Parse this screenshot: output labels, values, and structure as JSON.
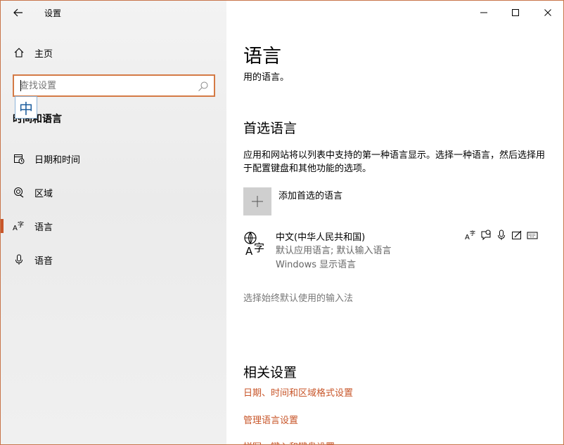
{
  "app": {
    "title": "设置"
  },
  "sidebar": {
    "home_label": "主页",
    "search": {
      "placeholder": "查找设置"
    },
    "ime_indicator": "中",
    "section_title": "时间和语言",
    "items": [
      {
        "label": "日期和时间",
        "icon": "calendar-clock-icon",
        "active": false
      },
      {
        "label": "区域",
        "icon": "globe-region-icon",
        "active": false
      },
      {
        "label": "语言",
        "icon": "language-icon",
        "active": true
      },
      {
        "label": "语音",
        "icon": "microphone-icon",
        "active": false
      }
    ]
  },
  "main": {
    "title": "语言",
    "subtitle": "用的语言。",
    "preferred": {
      "heading": "首选语言",
      "description": "应用和网站将以列表中支持的第一种语言显示。选择一种语言，然后选择用于配置键盘和其他功能的选项。",
      "add_label": "添加首选的语言",
      "language": {
        "name": "中文(中华人民共和国)",
        "detail1": "默认应用语言; 默认输入语言",
        "detail2": "Windows 显示语言",
        "feature_icons": [
          "text-language-icon",
          "speech-bubble-icon",
          "microphone-icon",
          "handwriting-icon",
          "keyboard-icon"
        ]
      }
    },
    "input_method_link": "选择始终默认使用的输入法",
    "related": {
      "heading": "相关设置",
      "links": [
        "日期、时间和区域格式设置",
        "管理语言设置",
        "拼写、键入和键盘设置"
      ]
    }
  },
  "colors": {
    "accent": "#c8562a",
    "sidebar_bg": "#f0f0f0",
    "search_border": "#d47a45"
  }
}
